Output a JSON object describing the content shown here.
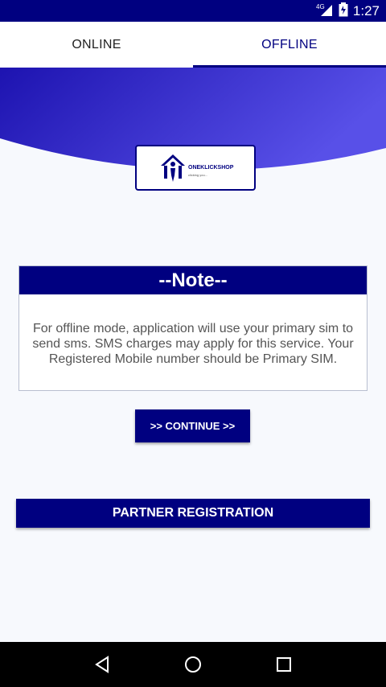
{
  "status_bar": {
    "network": "4G",
    "time": "1:27"
  },
  "tabs": [
    {
      "label": "ONLINE",
      "selected": false
    },
    {
      "label": "OFFLINE",
      "selected": true
    }
  ],
  "logo": {
    "brand": "ONEKLICKSHOP",
    "tagline": "clicking you..."
  },
  "note": {
    "title": "--Note--",
    "body": "For offline mode, application will use your primary sim to send sms. SMS charges may apply for this service. Your Registered Mobile number should be Primary SIM."
  },
  "buttons": {
    "continue": ">> CONTINUE >>",
    "partner_registration": "PARTNER REGISTRATION"
  },
  "colors": {
    "primary": "#000080",
    "accent_gradient_end": "#5850e8",
    "background": "#f7f9fd"
  }
}
